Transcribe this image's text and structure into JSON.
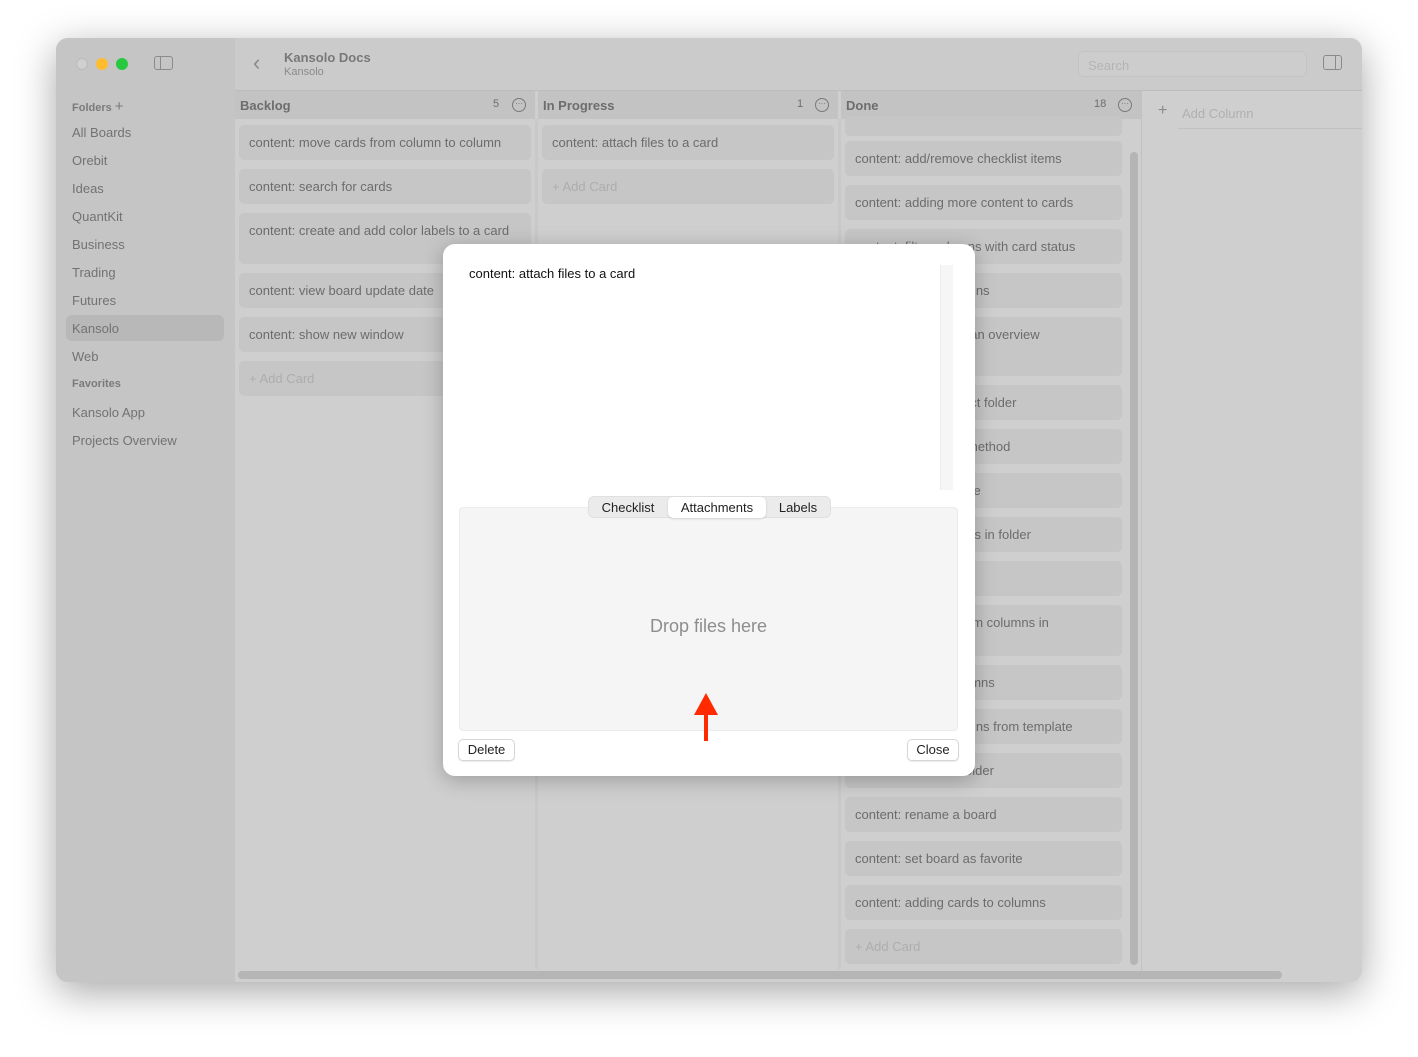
{
  "window": {
    "title": "Kansolo Docs",
    "subtitle": "Kansolo",
    "search_placeholder": "Search"
  },
  "sidebar": {
    "folders_label": "Folders",
    "items": [
      "All Boards",
      "Orebit",
      "Ideas",
      "QuantKit",
      "Business",
      "Trading",
      "Futures",
      "Kansolo",
      "Web"
    ],
    "selected": "Kansolo",
    "favorites_label": "Favorites",
    "favorites": [
      "Kansolo App",
      "Projects Overview"
    ]
  },
  "columns": [
    {
      "title": "Backlog",
      "count": "5",
      "cards": [
        "content: move cards from column to column",
        "content: search for cards",
        "content: create and add color labels to a card",
        "content: view board update date",
        "content: show new window"
      ],
      "add": "+ Add Card"
    },
    {
      "title": "In Progress",
      "count": "1",
      "cards": [
        "content: attach files to a card"
      ],
      "add": "+ Add Card"
    },
    {
      "title": "Done",
      "count": "18",
      "cards": [
        "content: add/remove checklist items",
        "content: adding more content to cards",
        "content: filter columns with card status",
        "mns",
        "ban overview",
        "ect folder",
        "method",
        "ce",
        "rds in folder",
        "l",
        "om columns in",
        "umns",
        "mns from template",
        "older",
        "content: rename a board",
        "content: set board as favorite",
        "content: adding cards to columns"
      ],
      "add": "+ Add Card"
    }
  ],
  "add_column": "Add Column",
  "modal": {
    "card_text": "content: attach files to a card",
    "tabs": [
      "Checklist",
      "Attachments",
      "Labels"
    ],
    "active_tab": "Attachments",
    "drop_text": "Drop files here",
    "delete": "Delete",
    "close": "Close"
  },
  "colors": {
    "arrow": "#ff2a00",
    "close_light": "#d4d4d4",
    "minimize_light": "#febc2e",
    "zoom_light": "#28c840"
  }
}
